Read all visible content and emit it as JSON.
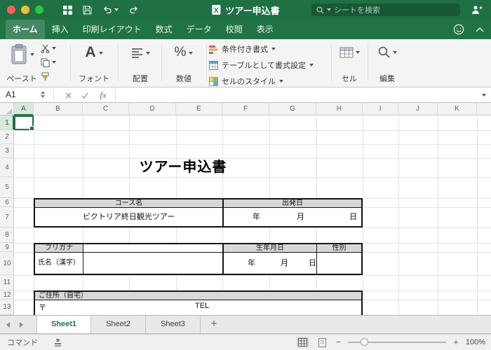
{
  "colors": {
    "brand_green": "#217346",
    "titlebar_green": "#1f7145",
    "ribbon_bg": "#f4f4f4",
    "header_sel_bg": "#d7e8de",
    "table_header_gray": "#d8d8d8",
    "grid_line": "#e3e3e3"
  },
  "titlebar": {
    "window_title": "ツアー申込書",
    "search_placeholder": "シートを検索"
  },
  "ribbon_tabs": [
    {
      "label": "ホーム",
      "active": true
    },
    {
      "label": "挿入"
    },
    {
      "label": "印刷レイアウト"
    },
    {
      "label": "数式"
    },
    {
      "label": "データ"
    },
    {
      "label": "校閲"
    },
    {
      "label": "表示"
    }
  ],
  "ribbon": {
    "paste_label": "ペースト",
    "font_label": "フォント",
    "alignment_label": "配置",
    "number_label": "数値",
    "conditional_formatting_label": "条件付き書式",
    "format_as_table_label": "テーブルとして書式設定",
    "cell_styles_label": "セルのスタイル",
    "cells_label": "セル",
    "editing_label": "編集"
  },
  "formula_bar": {
    "name_box": "A1",
    "fx_label": "fx"
  },
  "grid": {
    "columns": [
      "A",
      "B",
      "C",
      "D",
      "E",
      "F",
      "G",
      "H",
      "I",
      "J",
      "K"
    ],
    "rows": [
      "1",
      "2",
      "3",
      "4",
      "5",
      "6",
      "7",
      "8",
      "9",
      "10",
      "11",
      "12",
      "13"
    ],
    "selected_cell": "A1"
  },
  "sheet_content": {
    "doc_title": "ツアー申込書",
    "course_table": {
      "course_header": "コース名",
      "departure_header": "出発日",
      "course_value": "ビクトリア終日観光ツアー",
      "date_units": {
        "year": "年",
        "month": "月",
        "day": "日"
      }
    },
    "name_table": {
      "furigana_label": "フリガナ",
      "birthdate_label": "生年月日",
      "gender_label": "性別",
      "name_label": "氏名（漢字）",
      "date_units": {
        "year": "年",
        "month": "月",
        "day": "日"
      }
    },
    "address_table": {
      "address_label": "ご住所（自宅）",
      "postal_mark": "〒",
      "tel_label": "TEL"
    }
  },
  "sheet_tabs": {
    "tabs": [
      {
        "label": "Sheet1",
        "active": true
      },
      {
        "label": "Sheet2"
      },
      {
        "label": "Sheet3"
      }
    ],
    "add_label": "+"
  },
  "status_bar": {
    "left_label": "コマンド",
    "zoom_out": "−",
    "zoom_in": "+",
    "zoom_level": "100%"
  }
}
